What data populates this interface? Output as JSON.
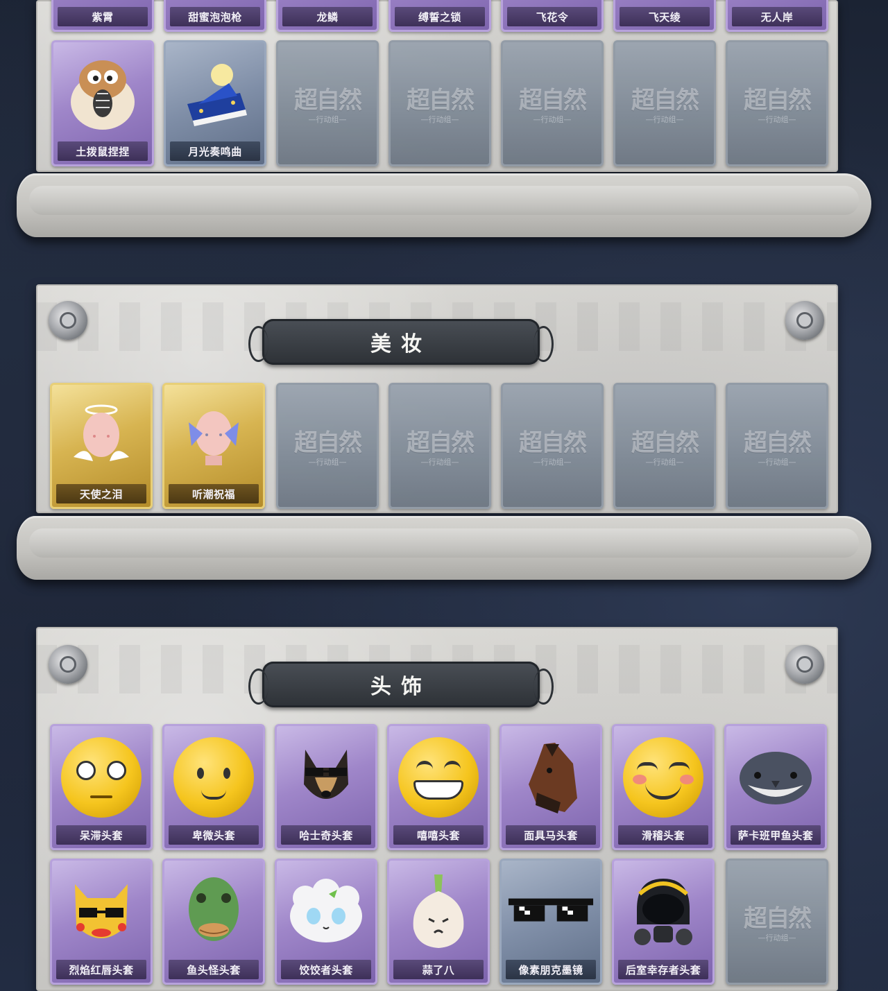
{
  "panels": {
    "top": {
      "row1_labels": [
        "紫霄",
        "甜蜜泡泡枪",
        "龙鳞",
        "缚誓之锁",
        "飞花令",
        "飞天绫",
        "无人岸"
      ],
      "row2": [
        {
          "label": "土拨鼠捏捏",
          "rarity": "purple",
          "icon": "hamster-icon"
        },
        {
          "label": "月光奏鸣曲",
          "rarity": "blue",
          "icon": "piano-icon"
        }
      ]
    },
    "makeup": {
      "title": "美妆",
      "items": [
        {
          "label": "天使之泪",
          "rarity": "gold",
          "icon": "angel-face-icon"
        },
        {
          "label": "听潮祝福",
          "rarity": "gold",
          "icon": "butterfly-face-icon"
        }
      ]
    },
    "headwear": {
      "title": "头饰",
      "row1": [
        {
          "label": "呆滞头套",
          "rarity": "purple",
          "icon": "stunned-emoji-icon"
        },
        {
          "label": "卑微头套",
          "rarity": "purple",
          "icon": "humble-emoji-icon"
        },
        {
          "label": "哈士奇头套",
          "rarity": "purple",
          "icon": "husky-head-icon"
        },
        {
          "label": "嘻嘻头套",
          "rarity": "purple",
          "icon": "grin-emoji-icon"
        },
        {
          "label": "面具马头套",
          "rarity": "purple",
          "icon": "horse-head-icon"
        },
        {
          "label": "滑稽头套",
          "rarity": "purple",
          "icon": "funny-emoji-icon"
        },
        {
          "label": "萨卡班甲鱼头套",
          "rarity": "purple",
          "icon": "fish-head-icon"
        }
      ],
      "row2": [
        {
          "label": "烈焰红唇头套",
          "rarity": "purple",
          "icon": "yellow-mask-icon"
        },
        {
          "label": "鱼头怪头套",
          "rarity": "purple",
          "icon": "fishman-head-icon"
        },
        {
          "label": "饺饺者头套",
          "rarity": "purple",
          "icon": "dumpling-head-icon"
        },
        {
          "label": "蒜了八",
          "rarity": "purple",
          "icon": "garlic-head-icon"
        },
        {
          "label": "像素朋克墨镜",
          "rarity": "blue",
          "icon": "pixel-sunglasses-icon"
        },
        {
          "label": "后室幸存者头套",
          "rarity": "purple",
          "icon": "gas-mask-icon"
        }
      ]
    }
  },
  "placeholder": {
    "big": "超自然",
    "small": "—行动组—"
  },
  "colors": {
    "purple": "#9f86c9",
    "gold": "#d7b451",
    "blue": "#7f8ea7",
    "banner": "#2d3136"
  }
}
